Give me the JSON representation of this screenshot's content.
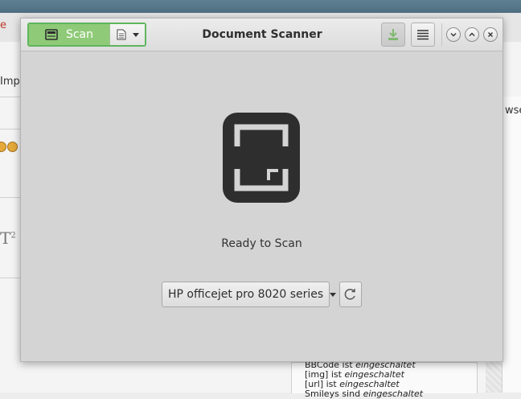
{
  "window": {
    "title": "Document Scanner"
  },
  "toolbar": {
    "scan_label": "Scan",
    "scan_icon": "scanner-icon",
    "document_type_icon": "document-icon",
    "save_icon": "save-download-icon",
    "menu_icon": "hamburger-menu-icon"
  },
  "main": {
    "status": "Ready to Scan",
    "device_selected": "HP officejet pro 8020 series",
    "refresh_icon": "refresh-icon"
  },
  "background": {
    "left_fragment": "Imp",
    "right_fragment": "wsei",
    "bbcode_lines": [
      {
        "prefix": "BBCode ist ",
        "state": "eingeschaltet"
      },
      {
        "prefix": "[img] ist ",
        "state": "eingeschaltet"
      },
      {
        "prefix": "[url] ist ",
        "state": "eingeschaltet"
      },
      {
        "prefix": "Smileys sind ",
        "state": "eingeschaltet"
      }
    ],
    "t2_glyph": "T",
    "t2_superscript": "2"
  },
  "colors": {
    "scan_accent": "#8fca78",
    "scan_border": "#5fb55d",
    "window_bg": "#d4d4d4",
    "scanner_icon": "#2e2e2e"
  }
}
